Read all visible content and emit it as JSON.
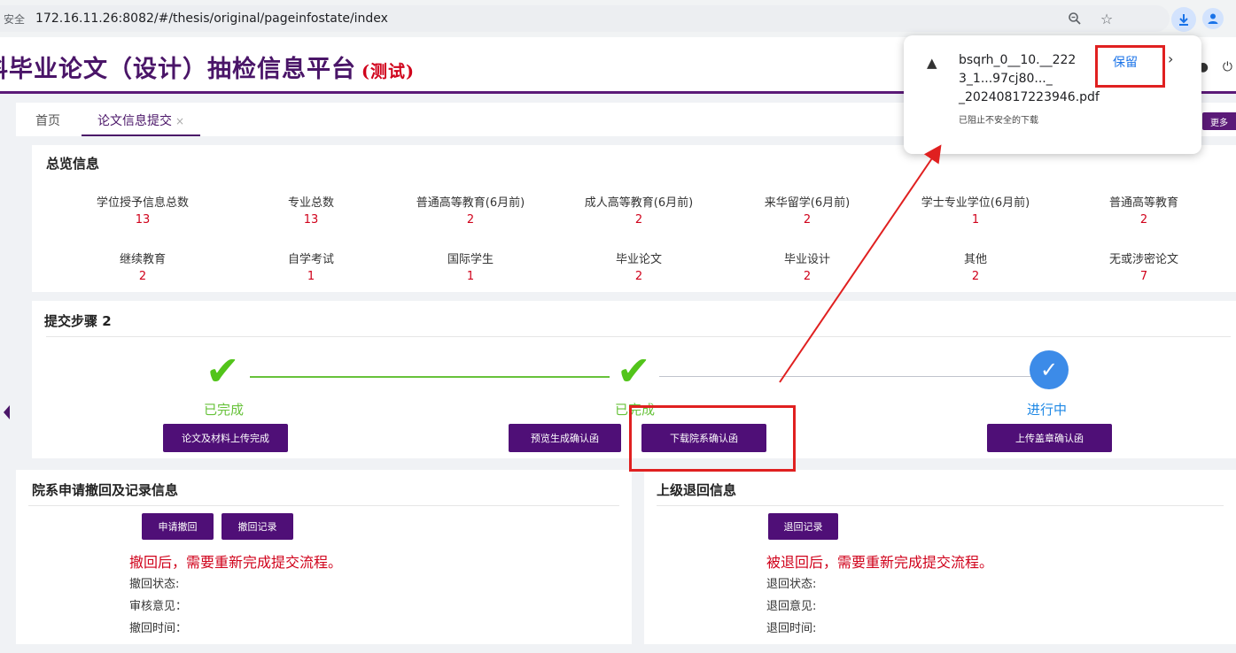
{
  "browser": {
    "security_label": "安全",
    "url": "172.16.11.26:8082/#/thesis/original/pageinfostate/index",
    "icons": [
      "zoom-icon",
      "star-icon",
      "download-icon",
      "profile-icon"
    ]
  },
  "header": {
    "title": "科毕业论文（设计）抽检信息平台",
    "test_badge": "(测试)"
  },
  "tabs": {
    "home": "首页",
    "active": "论文信息提交",
    "close": "×",
    "more": "更多"
  },
  "overview": {
    "title": "总览信息",
    "row1": [
      {
        "label": "学位授予信息总数",
        "value": "13"
      },
      {
        "label": "专业总数",
        "value": "13"
      },
      {
        "label": "普通高等教育(6月前)",
        "value": "2"
      },
      {
        "label": "成人高等教育(6月前)",
        "value": "2"
      },
      {
        "label": "来华留学(6月前)",
        "value": "2"
      },
      {
        "label": "学士专业学位(6月前)",
        "value": "1"
      },
      {
        "label": "普通高等教育",
        "value": "2"
      }
    ],
    "row2": [
      {
        "label": "继续教育",
        "value": "2"
      },
      {
        "label": "自学考试",
        "value": "1"
      },
      {
        "label": "国际学生",
        "value": "1"
      },
      {
        "label": "毕业论文",
        "value": "2"
      },
      {
        "label": "毕业设计",
        "value": "2"
      },
      {
        "label": "其他",
        "value": "2"
      },
      {
        "label": "无或涉密论文",
        "value": "7"
      }
    ]
  },
  "steps": {
    "title": "提交步骤 2",
    "step1_status": "已完成",
    "step2_status": "已完成",
    "step3_status": "进行中",
    "btn_upload_done": "论文及材料上传完成",
    "btn_preview": "预览生成确认函",
    "btn_download": "下载院系确认函",
    "btn_upload_stamp": "上传盖章确认函"
  },
  "withdraw": {
    "title": "院系申请撤回及记录信息",
    "btn_apply": "申请撤回",
    "btn_record": "撤回记录",
    "warning": "撤回后，需要重新完成提交流程。",
    "status_label": "撤回状态:",
    "opinion_label": "审核意见：",
    "time_label": "撤回时间："
  },
  "returned": {
    "title": "上级退回信息",
    "btn_record": "退回记录",
    "warning": "被退回后，需要重新完成提交流程。",
    "status_label": "退回状态:",
    "opinion_label": "退回意见:",
    "time_label": "退回时间:"
  },
  "download_popup": {
    "filename_line1": "bsqrh_0__10.__222",
    "filename_line2": "3_1..97cj80..\u0000_",
    "filename_line3": "_20240817223946.pdf",
    "blocked_text": "已阻止不安全的下载",
    "keep_label": "保留"
  },
  "colors": {
    "brand_purple": "#4f0f77",
    "done_green": "#67c23a",
    "doing_blue": "#1e88e5",
    "alert_red": "#d0021b"
  }
}
